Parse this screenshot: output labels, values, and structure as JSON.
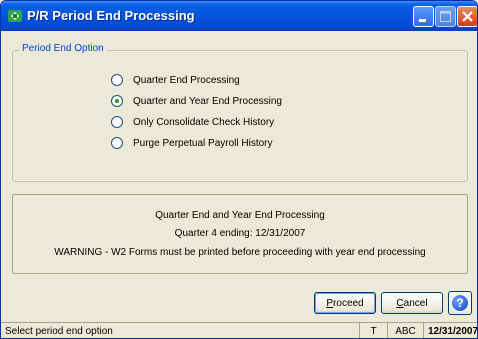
{
  "window": {
    "title": "P/R Period End Processing",
    "app_icon": "sage-app-icon",
    "controls": [
      "minimize-icon",
      "maximize-icon",
      "close-icon"
    ]
  },
  "period_end_option": {
    "legend": "Period End Option",
    "selected_index": 1,
    "options": [
      {
        "label": "Quarter End Processing",
        "checked": false
      },
      {
        "label": "Quarter and Year End Processing",
        "checked": true
      },
      {
        "label": "Only Consolidate Check History",
        "checked": false
      },
      {
        "label": "Purge Perpetual Payroll History",
        "checked": false
      }
    ]
  },
  "info": {
    "line1": "Quarter End and Year End Processing",
    "line2": "Quarter 4 ending: 12/31/2007",
    "line3": "WARNING - W2 Forms must be printed before proceeding with year end processing"
  },
  "buttons": {
    "proceed_prefix": "",
    "proceed_mnemonic": "P",
    "proceed_rest": "roceed",
    "cancel_prefix": "",
    "cancel_mnemonic": "C",
    "cancel_rest": "ancel",
    "help_icon": "help-icon",
    "help_glyph": "?"
  },
  "status_bar": {
    "message": "Select period end option",
    "mode": "T",
    "company": "ABC",
    "date": "12/31/2007"
  },
  "colors": {
    "titlebar": "#0553dd",
    "legend_text": "#0046d5",
    "radio_dot": "#21a121",
    "window_bg": "#ece9d8"
  }
}
